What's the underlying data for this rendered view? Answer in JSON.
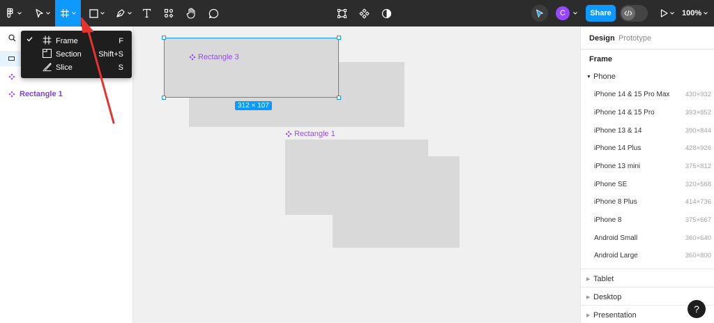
{
  "toolbar": {
    "tools": [
      {
        "name": "main-menu",
        "icon": "figma-menu-icon"
      },
      {
        "name": "move",
        "icon": "move-pointer-icon"
      },
      {
        "name": "frame",
        "icon": "frame-hash-icon",
        "active": true
      },
      {
        "name": "shape",
        "icon": "rectangle-icon"
      },
      {
        "name": "pen",
        "icon": "pen-icon"
      },
      {
        "name": "text",
        "icon": "text-icon",
        "glyph": "T"
      },
      {
        "name": "resources",
        "icon": "resources-icon"
      },
      {
        "name": "hand",
        "icon": "hand-icon"
      },
      {
        "name": "comment",
        "icon": "comment-icon"
      }
    ],
    "center_tools": [
      "crop-frame-icon",
      "component-icon",
      "contrast-icon"
    ],
    "avatar_initial": "C",
    "share_label": "Share",
    "zoom_label": "100%",
    "accent_color": "#0d99ff"
  },
  "frame_menu": {
    "items": [
      {
        "label": "Frame",
        "shortcut": "F",
        "checked": true,
        "icon": "frame-hash-icon"
      },
      {
        "label": "Section",
        "shortcut": "Shift+S",
        "checked": false,
        "icon": "section-icon"
      },
      {
        "label": "Slice",
        "shortcut": "S",
        "checked": false,
        "icon": "slice-icon"
      }
    ]
  },
  "layers": {
    "rows": [
      {
        "label": "Rectangle 1",
        "icon": "component-instance-icon"
      }
    ]
  },
  "canvas": {
    "labels": {
      "rect3": "Rectangle 3",
      "rect1": "Rectangle 1"
    },
    "dimension_badge": "312 × 107",
    "label_color": "#9747ff"
  },
  "design_panel": {
    "tabs": [
      {
        "label": "Design",
        "active": true
      },
      {
        "label": "Prototype",
        "active": false
      }
    ],
    "section_title": "Frame",
    "open_category": "Phone",
    "devices": [
      {
        "name": "iPhone 14 & 15 Pro Max",
        "size": "430×932"
      },
      {
        "name": "iPhone 14 & 15 Pro",
        "size": "393×852"
      },
      {
        "name": "iPhone 13 & 14",
        "size": "390×844"
      },
      {
        "name": "iPhone 14 Plus",
        "size": "428×926"
      },
      {
        "name": "iPhone 13 mini",
        "size": "375×812"
      },
      {
        "name": "iPhone SE",
        "size": "320×568"
      },
      {
        "name": "iPhone 8 Plus",
        "size": "414×736"
      },
      {
        "name": "iPhone 8",
        "size": "375×667"
      },
      {
        "name": "Android Small",
        "size": "360×640"
      },
      {
        "name": "Android Large",
        "size": "360×800"
      }
    ],
    "closed_categories": [
      "Tablet",
      "Desktop",
      "Presentation"
    ]
  },
  "help_label": "?"
}
